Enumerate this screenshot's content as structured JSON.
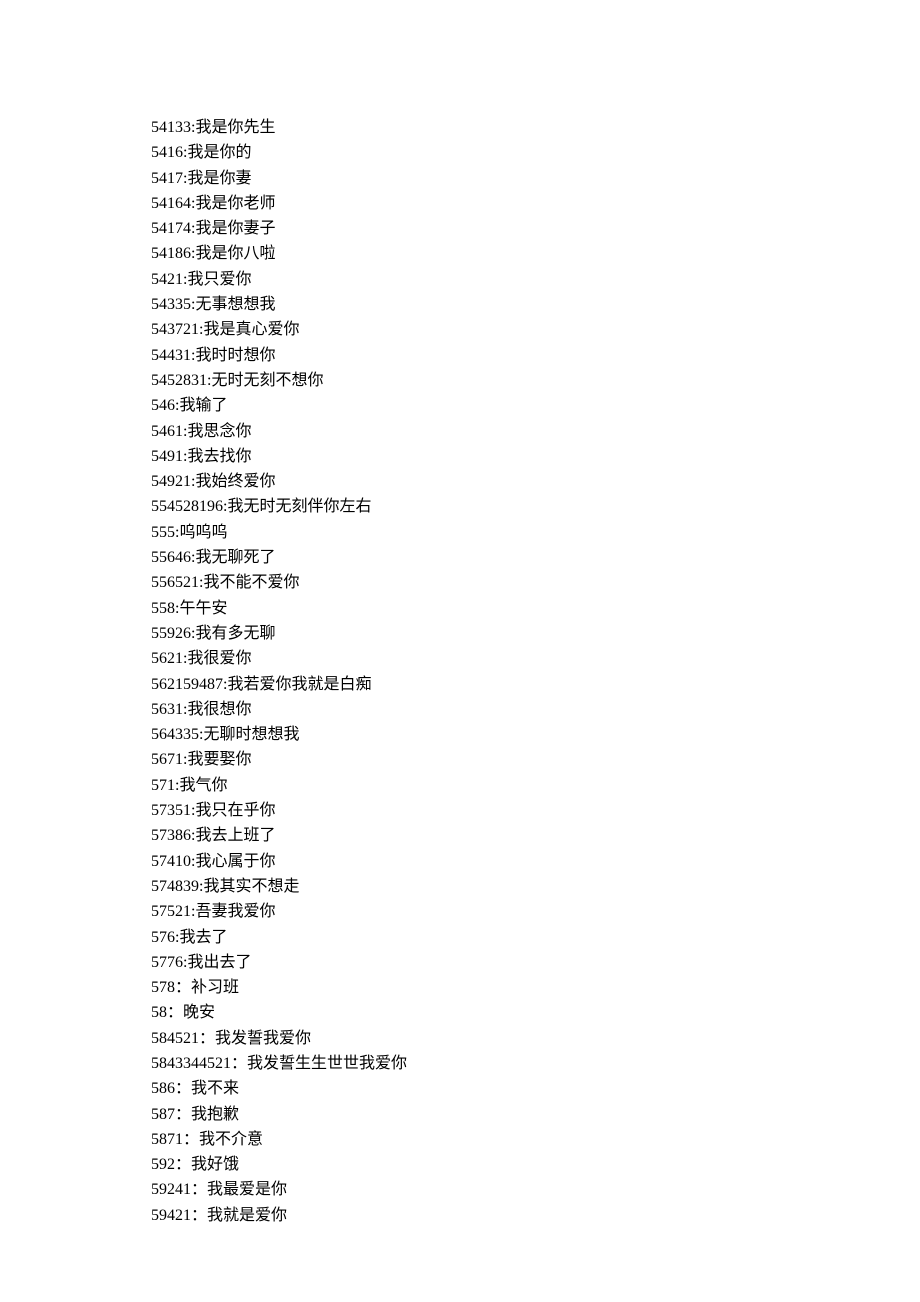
{
  "lines": [
    "54133:我是你先生",
    "5416:我是你的",
    "5417:我是你妻",
    "54164:我是你老师",
    "54174:我是你妻子",
    "54186:我是你八啦",
    "5421:我只爱你",
    "54335:无事想想我",
    "543721:我是真心爱你",
    "54431:我时时想你",
    "5452831:无时无刻不想你",
    "546:我输了",
    "5461:我思念你",
    "5491:我去找你",
    "54921:我始终爱你",
    "554528196:我无时无刻伴你左右",
    "555:呜呜呜",
    "55646:我无聊死了",
    "556521:我不能不爱你",
    "558:午午安",
    "55926:我有多无聊",
    "5621:我很爱你",
    "562159487:我若爱你我就是白痴",
    "5631:我很想你",
    "564335:无聊时想想我",
    "5671:我要娶你",
    "571:我气你",
    "57351:我只在乎你",
    "57386:我去上班了",
    "57410:我心属于你",
    "574839:我其实不想走",
    "57521:吾妻我爱你",
    "576:我去了",
    "5776:我出去了",
    "578：补习班",
    "58：晚安",
    "584521：我发誓我爱你",
    "5843344521：我发誓生生世世我爱你",
    "586：我不来",
    "587：我抱歉",
    "5871：我不介意",
    "592：我好饿",
    "59241：我最爱是你",
    "59421：我就是爱你"
  ]
}
